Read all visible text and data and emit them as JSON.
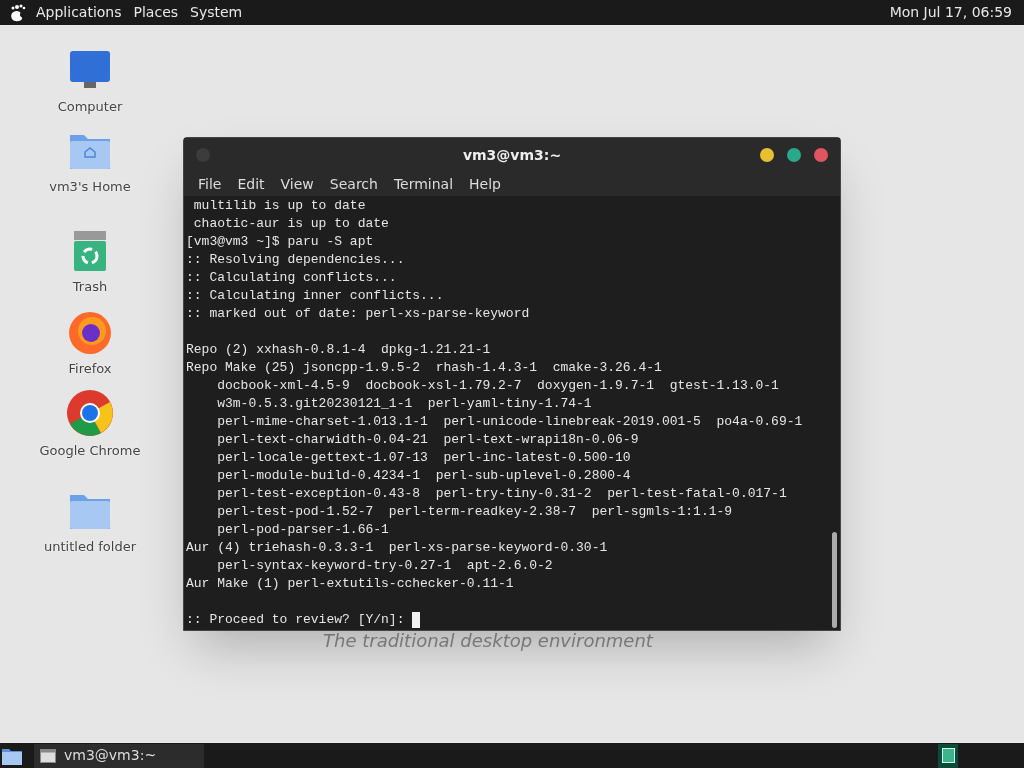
{
  "top_panel": {
    "menus": [
      "Applications",
      "Places",
      "System"
    ],
    "clock": "Mon Jul 17, 06:59"
  },
  "desktop_icons": [
    {
      "kind": "computer",
      "label": "Computer"
    },
    {
      "kind": "home",
      "label": "vm3's Home"
    },
    {
      "kind": "trash",
      "label": "Trash"
    },
    {
      "kind": "firefox",
      "label": "Firefox"
    },
    {
      "kind": "chrome",
      "label": "Google Chrome"
    },
    {
      "kind": "folder",
      "label": "untitled folder"
    }
  ],
  "wallpaper_tagline": "The traditional desktop environment",
  "terminal": {
    "title": "vm3@vm3:~",
    "menu": [
      "File",
      "Edit",
      "View",
      "Search",
      "Terminal",
      "Help"
    ],
    "lines": [
      {
        "kind": "text",
        "text": " multilib is up to date"
      },
      {
        "kind": "text",
        "text": " chaotic-aur is up to date"
      },
      {
        "kind": "text",
        "text": "[vm3@vm3 ~]$ paru -S apt"
      },
      {
        "kind": "text",
        "text": ":: Resolving dependencies..."
      },
      {
        "kind": "text",
        "text": ":: Calculating conflicts..."
      },
      {
        "kind": "text",
        "text": ":: Calculating inner conflicts..."
      },
      {
        "kind": "text",
        "text": ":: marked out of date: perl-xs-parse-keyword"
      },
      {
        "kind": "blank"
      },
      {
        "kind": "text",
        "text": "Repo (2) xxhash-0.8.1-4  dpkg-1.21.21-1"
      },
      {
        "kind": "text",
        "text": "Repo Make (25) jsoncpp-1.9.5-2  rhash-1.4.3-1  cmake-3.26.4-1"
      },
      {
        "kind": "text",
        "text": "    docbook-xml-4.5-9  docbook-xsl-1.79.2-7  doxygen-1.9.7-1  gtest-1.13.0-1"
      },
      {
        "kind": "text",
        "text": "    w3m-0.5.3.git20230121_1-1  perl-yaml-tiny-1.74-1"
      },
      {
        "kind": "text",
        "text": "    perl-mime-charset-1.013.1-1  perl-unicode-linebreak-2019.001-5  po4a-0.69-1"
      },
      {
        "kind": "text",
        "text": "    perl-text-charwidth-0.04-21  perl-text-wrapi18n-0.06-9"
      },
      {
        "kind": "text",
        "text": "    perl-locale-gettext-1.07-13  perl-inc-latest-0.500-10"
      },
      {
        "kind": "text",
        "text": "    perl-module-build-0.4234-1  perl-sub-uplevel-0.2800-4"
      },
      {
        "kind": "text",
        "text": "    perl-test-exception-0.43-8  perl-try-tiny-0.31-2  perl-test-fatal-0.017-1"
      },
      {
        "kind": "text",
        "text": "    perl-test-pod-1.52-7  perl-term-readkey-2.38-7  perl-sgmls-1:1.1-9"
      },
      {
        "kind": "text",
        "text": "    perl-pod-parser-1.66-1"
      },
      {
        "kind": "text",
        "text": "Aur (4) triehash-0.3.3-1  perl-xs-parse-keyword-0.30-1"
      },
      {
        "kind": "text",
        "text": "    perl-syntax-keyword-try-0.27-1  apt-2.6.0-2"
      },
      {
        "kind": "text",
        "text": "Aur Make (1) perl-extutils-cchecker-0.11-1"
      },
      {
        "kind": "blank"
      },
      {
        "kind": "prompt",
        "text": ":: Proceed to review? [Y/n]: "
      }
    ]
  },
  "taskbar": {
    "tasks": [
      {
        "label": "vm3@vm3:~",
        "selected": false
      }
    ]
  }
}
